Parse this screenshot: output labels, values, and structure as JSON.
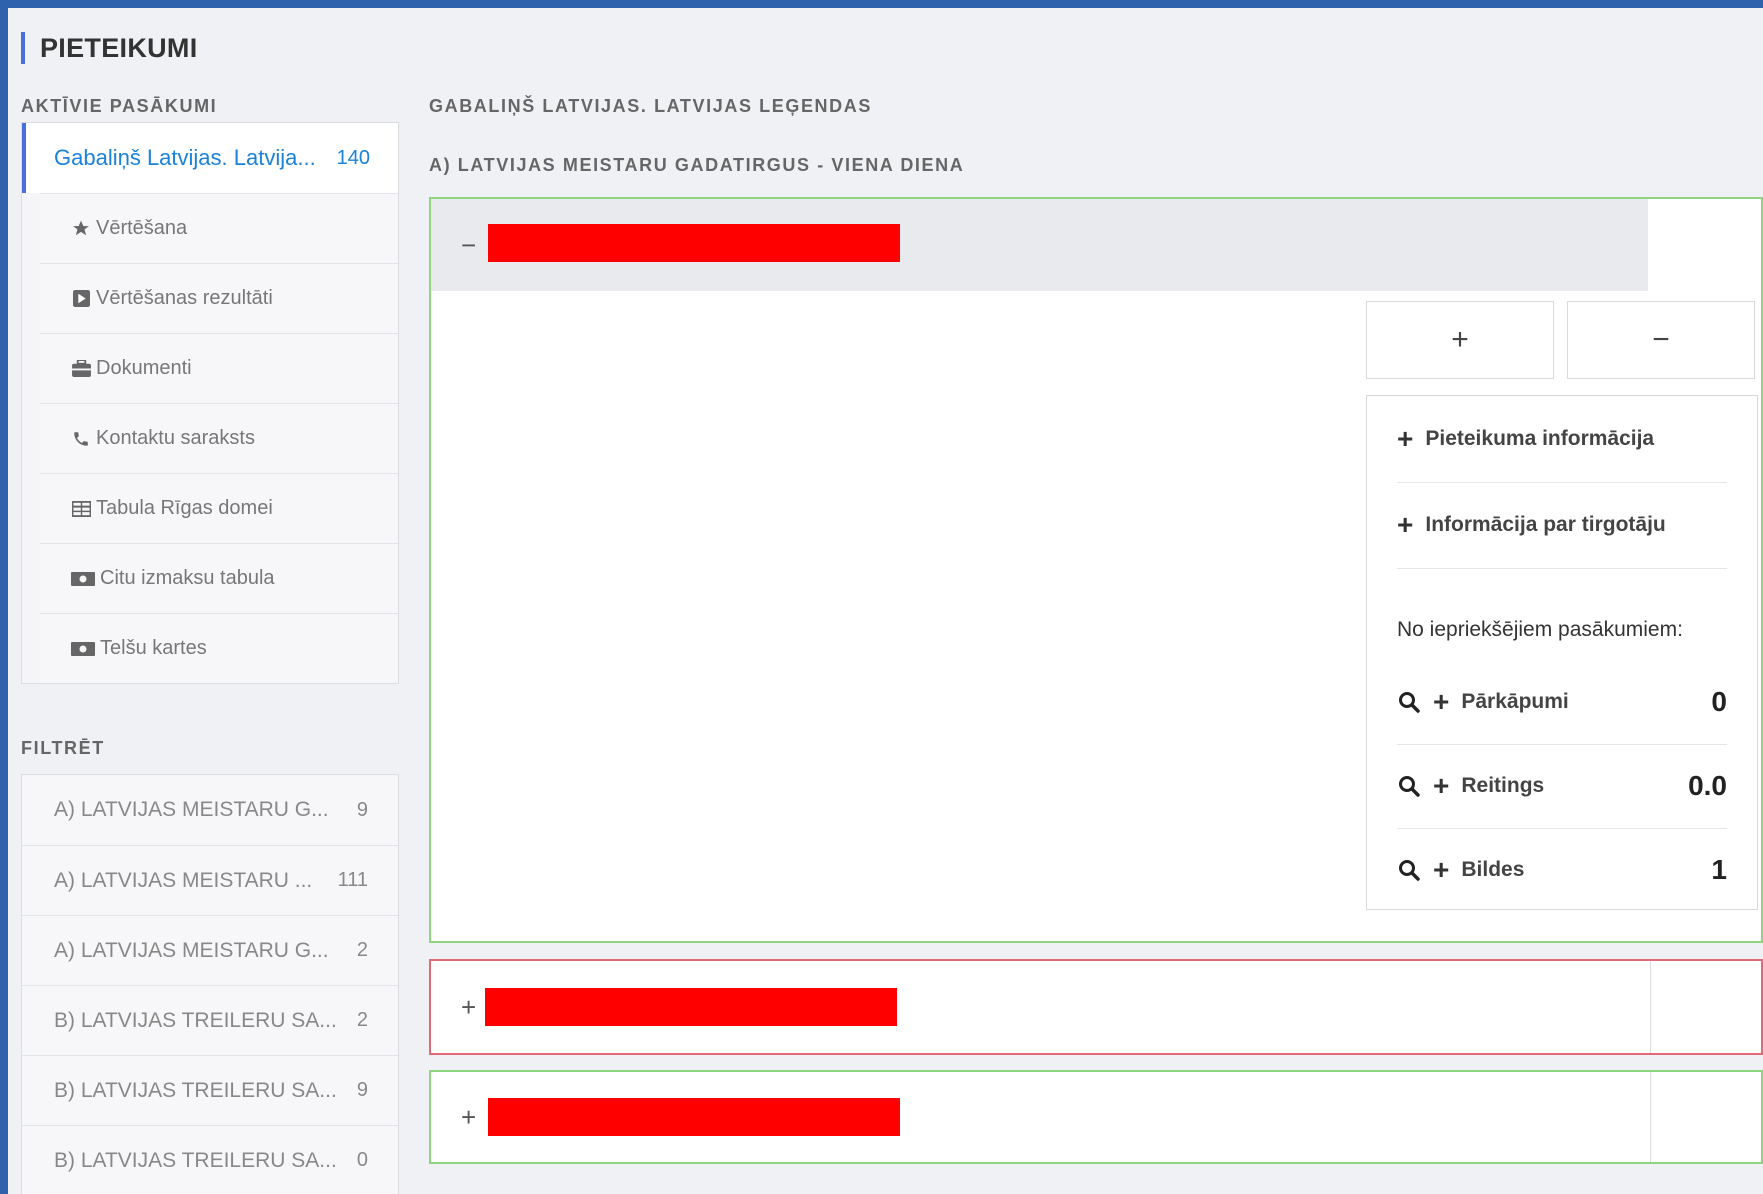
{
  "page_title": "PIETEIKUMI",
  "sidebar": {
    "active_label": "AKTĪVIE PASĀKUMI",
    "active_event": {
      "label": "Gabaliņš Latvijas. Latvija...",
      "count": "140"
    },
    "sub_items": [
      {
        "label": "Vērtēšana",
        "icon": "star-icon"
      },
      {
        "label": "Vērtēšanas rezultāti",
        "icon": "play-square-icon"
      },
      {
        "label": "Dokumenti",
        "icon": "briefcase-icon"
      },
      {
        "label": "Kontaktu saraksts",
        "icon": "phone-icon"
      },
      {
        "label": "Tabula Rīgas domei",
        "icon": "table-icon"
      },
      {
        "label": "Citu izmaksu tabula",
        "icon": "money-icon"
      },
      {
        "label": "Telšu kartes",
        "icon": "money-icon"
      }
    ],
    "filter_label": "FILTRĒT",
    "filters": [
      {
        "label": "A) LATVIJAS MEISTARU G...",
        "count": "9"
      },
      {
        "label": "A) LATVIJAS MEISTARU ...",
        "count": "111"
      },
      {
        "label": "A) LATVIJAS MEISTARU G...",
        "count": "2"
      },
      {
        "label": "B) LATVIJAS TREILERU SA...",
        "count": "2"
      },
      {
        "label": "B) LATVIJAS TREILERU SA...",
        "count": "9"
      },
      {
        "label": "B) LATVIJAS TREILERU SA...",
        "count": "0"
      }
    ]
  },
  "main": {
    "event_title": "GABALIŅŠ LATVIJAS. LATVIJAS LEĢENDAS",
    "category_title": "A) LATVIJAS MEISTARU GADATIRGUS - VIENA DIENA",
    "expanded": {
      "toggle": "−",
      "plus_btn": "+",
      "minus_btn": "−",
      "links": [
        "Pieteikuma informācija",
        "Informācija par tirgotāju"
      ],
      "prev_title": "No iepriekšējiem pasākumiem:",
      "stats": [
        {
          "label": "Pārkāpumi",
          "value": "0"
        },
        {
          "label": "Reitings",
          "value": "0.0"
        },
        {
          "label": "Bildes",
          "value": "1"
        }
      ]
    },
    "collapsed_toggle": "+",
    "colors": {
      "accent": "#4a6fd9",
      "link": "#1a82d8",
      "ok_border": "#8fd47f",
      "warn_border": "#e06a78",
      "redacted": "#ff0000"
    }
  }
}
